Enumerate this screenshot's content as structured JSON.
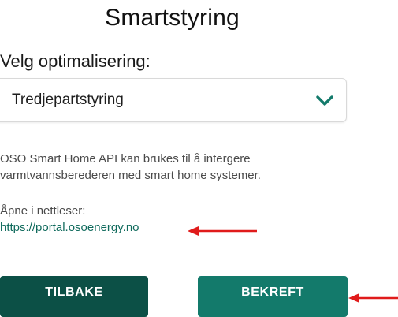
{
  "page": {
    "title": "Smartstyring"
  },
  "optimization": {
    "label": "Velg optimalisering:",
    "selected": "Tredjepartstyring"
  },
  "info": {
    "description": "OSO Smart Home API kan brukes til å intergere varmtvannsberederen med smart home systemer.",
    "open_label": "Åpne i nettleser:",
    "link_text": "https://portal.osoenergy.no"
  },
  "actions": {
    "back_label": "TILBAKE",
    "confirm_label": "BEKREFT"
  },
  "colors": {
    "accent": "#137a6b",
    "back_button": "#0c5046",
    "link": "#0f6a5c",
    "annotation_arrow": "#e01b1b"
  }
}
